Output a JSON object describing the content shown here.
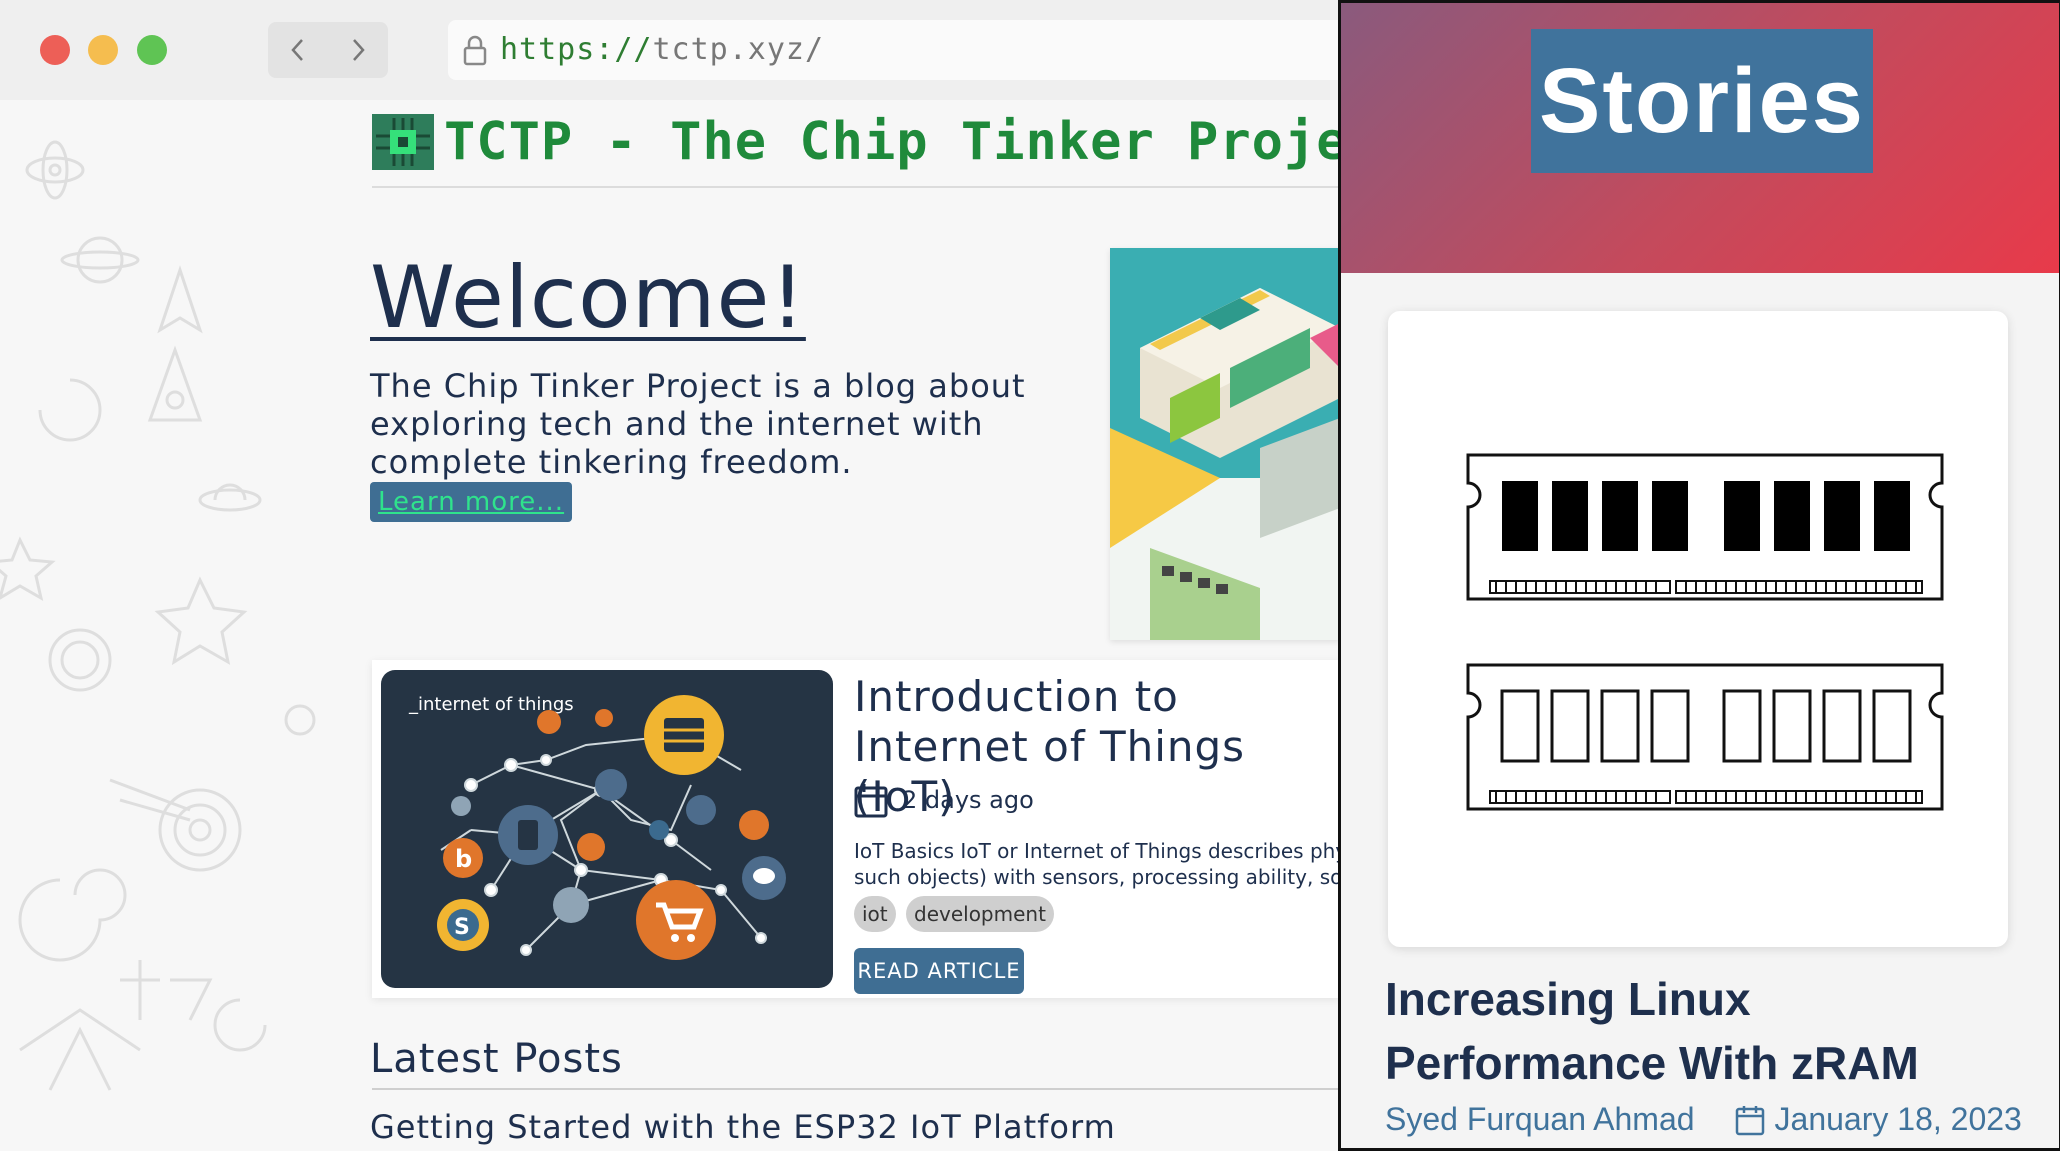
{
  "browser": {
    "url_scheme": "https://",
    "url_host": "tctp.xyz/",
    "buttons": {
      "back_icon": "chevron-left-icon",
      "forward_icon": "chevron-right-icon"
    },
    "traffic_lights": [
      "#ed5f57",
      "#f5bd4f",
      "#5fc454"
    ]
  },
  "site": {
    "title": "TCTP - The Chip Tinker Project",
    "accent_color": "#1f8a3b"
  },
  "hero": {
    "heading": "Welcome!",
    "description": "The Chip Tinker Project is a blog about exploring tech and the internet with complete tinkering freedom.",
    "learn_more": "Learn more..."
  },
  "featured_article": {
    "image_caption": "_internet of things",
    "title": "Introduction to Internet of Things\n(IoT)",
    "date": "2 days ago",
    "excerpt_line1": "IoT Basics IoT or Internet of Things describes physical objects (or groups of",
    "excerpt_line2": "such objects) with sensors, processing ability, software, and other technologies",
    "tags": [
      "iot",
      "development"
    ],
    "read_button": "READ ARTICLE"
  },
  "latest_posts": {
    "heading": "Latest Posts",
    "items": [
      "Getting Started with the ESP32 IoT Platform"
    ]
  },
  "stories": {
    "label": "Stories",
    "story": {
      "title": "Increasing Linux Performance With zRAM",
      "author": "Syed Furquan Ahmad",
      "date": "January 18, 2023"
    }
  }
}
